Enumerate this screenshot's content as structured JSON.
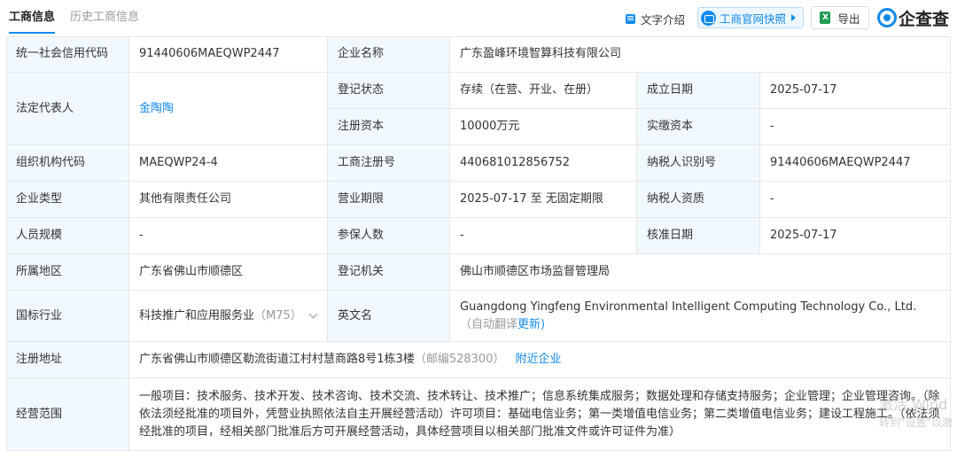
{
  "tabs": {
    "active": "工商信息",
    "history": "历史工商信息"
  },
  "toolbar": {
    "text_intro": "文字介绍",
    "snapshot": "工商官网快照",
    "export": "导出",
    "export_icon": "X",
    "logo_text": "企查查"
  },
  "rows": {
    "credit_code": {
      "label": "统一社会信用代码",
      "value": "91440606MAEQWP2447"
    },
    "company_name": {
      "label": "企业名称",
      "value": "广东盈峰环境智算科技有限公司"
    },
    "legal_rep": {
      "label": "法定代表人",
      "value": "金陶陶"
    },
    "reg_status": {
      "label": "登记状态",
      "value": "存续（在营、开业、在册）"
    },
    "est_date": {
      "label": "成立日期",
      "value": "2025-07-17"
    },
    "reg_capital": {
      "label": "注册资本",
      "value": "10000万元"
    },
    "paid_capital": {
      "label": "实缴资本",
      "value": "-"
    },
    "org_code": {
      "label": "组织机构代码",
      "value": "MAEQWP24-4"
    },
    "reg_no": {
      "label": "工商注册号",
      "value": "440681012856752"
    },
    "taxpayer_id": {
      "label": "纳税人识别号",
      "value": "91440606MAEQWP2447"
    },
    "company_type": {
      "label": "企业类型",
      "value": "其他有限责任公司"
    },
    "biz_term": {
      "label": "营业期限",
      "value": "2025-07-17 至 无固定期限"
    },
    "taxpayer_qual": {
      "label": "纳税人资质",
      "value": "-"
    },
    "staff_size": {
      "label": "人员规模",
      "value": "-"
    },
    "insured": {
      "label": "参保人数",
      "value": "-"
    },
    "approve_date": {
      "label": "核准日期",
      "value": "2025-07-17"
    },
    "region": {
      "label": "所属地区",
      "value": "广东省佛山市顺德区"
    },
    "authority": {
      "label": "登记机关",
      "value": "佛山市顺德区市场监督管理局"
    },
    "industry": {
      "label": "国标行业",
      "value": "科技推广和应用服务业",
      "code": "（M75）"
    },
    "english_name": {
      "label": "英文名",
      "value": "Guangdong Yingfeng Environmental Intelligent Computing Technology Co., Ltd.",
      "note": "（自动翻译",
      "update": "更新)"
    },
    "address": {
      "label": "注册地址",
      "value": "广东省佛山市顺德区勒流街道江村村慧商路8号1栋3楼",
      "postcode": "（邮编528300）",
      "nearby": "附近企业"
    },
    "scope": {
      "label": "经营范围",
      "value": "一般项目：技术服务、技术开发、技术咨询、技术交流、技术转让、技术推广；信息系统集成服务；数据处理和存储支持服务；企业管理；企业管理咨询。（除依法须经批准的项目外，凭营业执照依法自主开展经营活动）许可项目：基础电信业务；第一类增值电信业务；第二类增值电信业务；建设工程施工。（依法须经批准的项目，经相关部门批准后方可开展经营活动，具体经营项目以相关部门批准文件或许可证件为准）"
    }
  },
  "watermark": {
    "line1": "激活 Wind",
    "line2": "转到\"设置\"以激"
  }
}
